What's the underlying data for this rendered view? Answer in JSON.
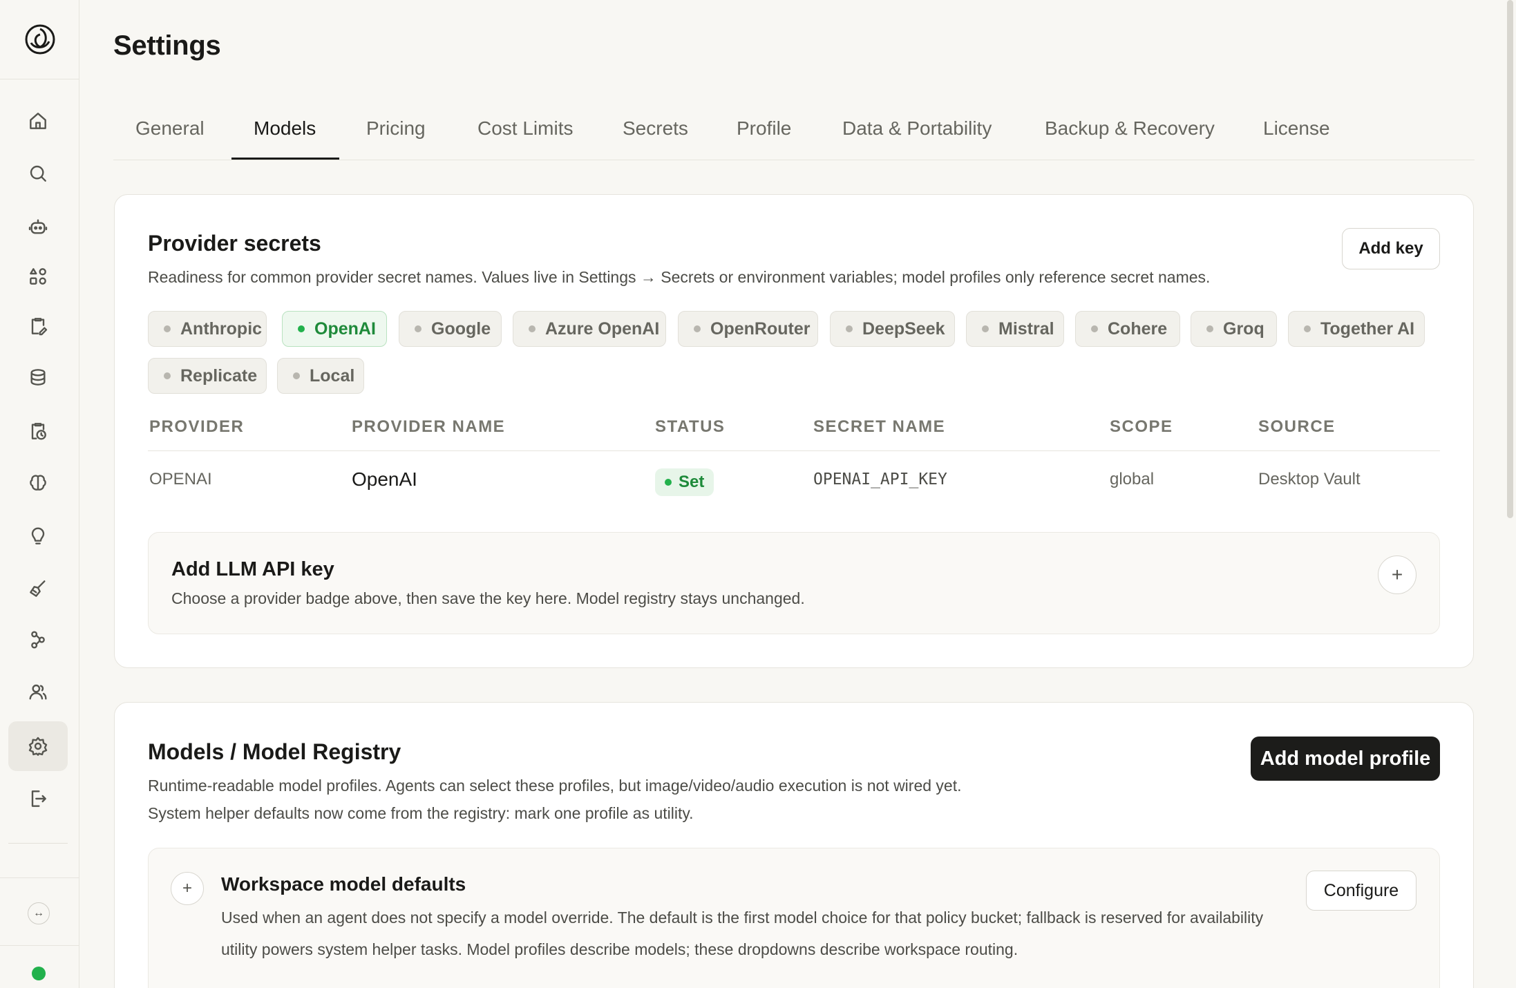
{
  "page": {
    "title": "Settings"
  },
  "tabs": [
    {
      "label": "General"
    },
    {
      "label": "Models",
      "active": true
    },
    {
      "label": "Pricing"
    },
    {
      "label": "Cost Limits"
    },
    {
      "label": "Secrets"
    },
    {
      "label": "Profile"
    },
    {
      "label": "Data & Portability"
    },
    {
      "label": "Backup & Recovery"
    },
    {
      "label": "License"
    }
  ],
  "sidebar": {
    "items": [
      {
        "icon": "home-icon"
      },
      {
        "icon": "search-icon"
      },
      {
        "icon": "robot-icon"
      },
      {
        "icon": "apps-icon"
      },
      {
        "icon": "clipboard-edit-icon"
      },
      {
        "icon": "database-icon"
      },
      {
        "icon": "clipboard-clock-icon"
      },
      {
        "icon": "brain-icon"
      },
      {
        "icon": "lightbulb-icon"
      },
      {
        "icon": "broom-icon"
      },
      {
        "icon": "workflow-icon"
      },
      {
        "icon": "users-icon"
      },
      {
        "icon": "gear-icon",
        "active": true
      },
      {
        "icon": "logout-icon"
      }
    ],
    "status_color": "#22b14c"
  },
  "provider_secrets": {
    "title": "Provider secrets",
    "subtitle": "Readiness for common provider secret names. Values live in Settings → Secrets or environment variables; model profiles only reference secret names.",
    "add_key_label": "Add key",
    "chips": [
      {
        "label": "Anthropic"
      },
      {
        "label": "OpenAI",
        "active": true
      },
      {
        "label": "Google"
      },
      {
        "label": "Azure OpenAI"
      },
      {
        "label": "OpenRouter"
      },
      {
        "label": "DeepSeek"
      },
      {
        "label": "Mistral"
      },
      {
        "label": "Cohere"
      },
      {
        "label": "Groq"
      },
      {
        "label": "Together AI"
      },
      {
        "label": "Replicate"
      },
      {
        "label": "Local"
      }
    ],
    "table": {
      "headers": [
        "PROVIDER",
        "PROVIDER NAME",
        "STATUS",
        "SECRET NAME",
        "SCOPE",
        "SOURCE"
      ],
      "rows": [
        {
          "provider": "OPENAI",
          "provider_name": "OpenAI",
          "status": "Set",
          "secret_name": "OPENAI_API_KEY",
          "scope": "global",
          "source": "Desktop Vault"
        }
      ]
    },
    "add_llm": {
      "title": "Add LLM API key",
      "subtitle": "Choose a provider badge above, then save the key here. Model registry stays unchanged.",
      "plus": "+"
    }
  },
  "model_registry": {
    "title": "Models / Model Registry",
    "subtitle_1": "Runtime-readable model profiles. Agents can select these profiles, but image/video/audio execution is not wired yet.",
    "subtitle_2": "System helper defaults now come from the registry: mark one profile as utility.",
    "add_profile_label": "Add model profile",
    "workspace_defaults": {
      "title": "Workspace model defaults",
      "desc_1": "Used when an agent does not specify a model override. The default is the first model choice for that policy bucket; fallback is reserved for availability",
      "desc_2": "utility powers system helper tasks. Model profiles describe models; these dropdowns describe workspace routing.",
      "configure_label": "Configure",
      "plus": "+"
    }
  },
  "colors": {
    "accent_green": "#22b14c",
    "dark_button": "#1c1c1a"
  }
}
